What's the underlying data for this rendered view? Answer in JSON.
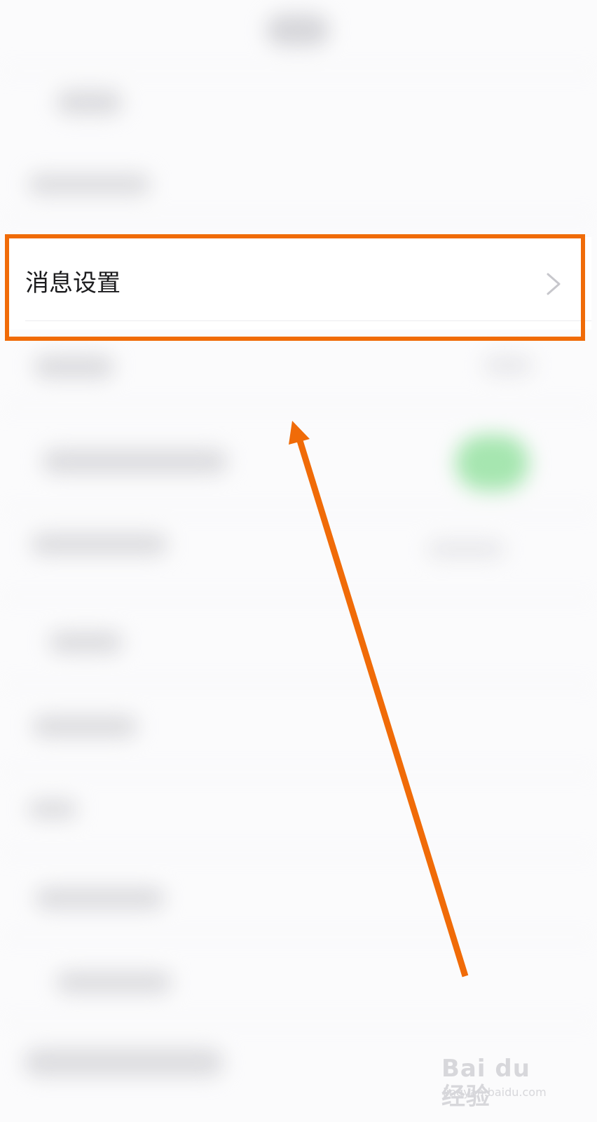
{
  "settings_row": {
    "label": "消息设置"
  },
  "watermark": {
    "main": "Bai du 经验",
    "sub": "jingyan.baidu.com"
  },
  "colors": {
    "highlight": "#f06b08",
    "background": "#fbfbfc"
  },
  "icons": {
    "chevron": "chevron-right-icon",
    "arrow": "up-arrow-annotation"
  }
}
